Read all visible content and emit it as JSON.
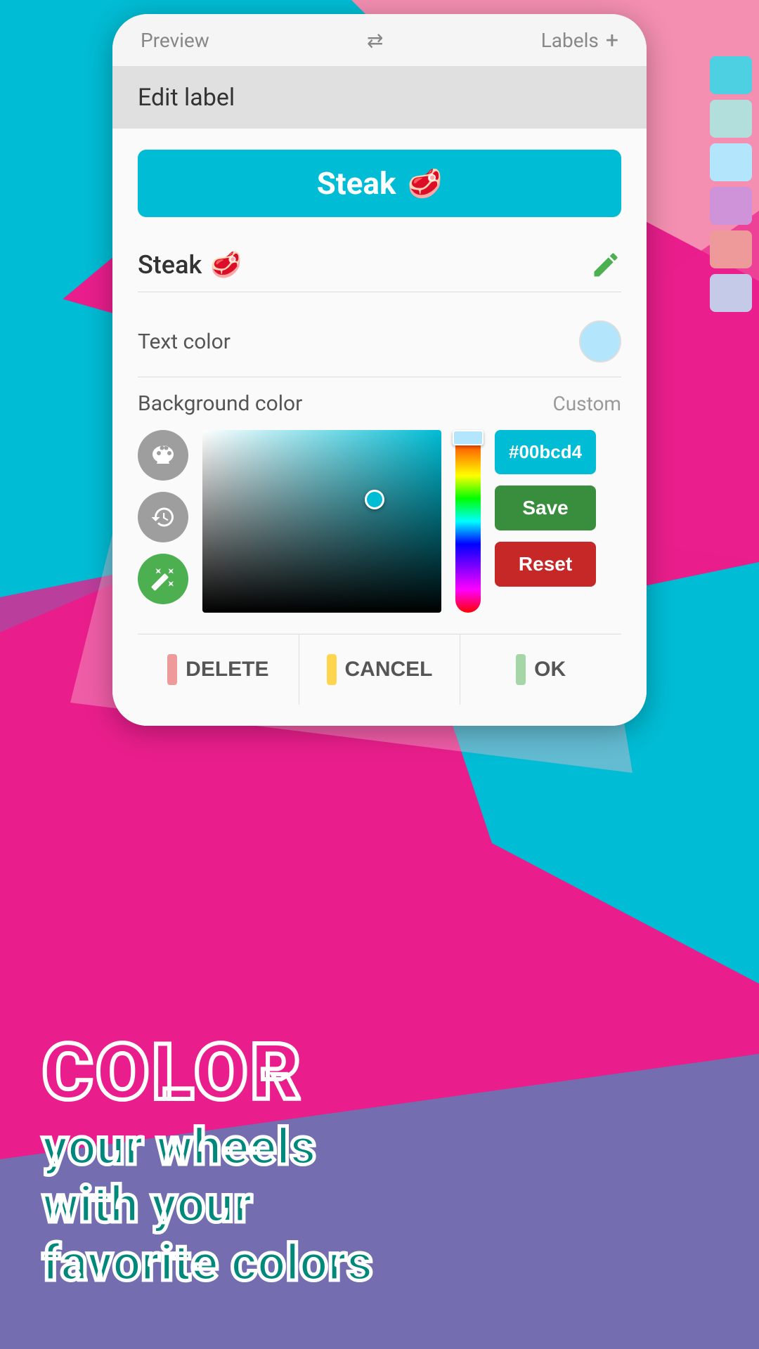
{
  "background": {
    "colors": [
      "#00bcd4",
      "#e91e8c",
      "#ce93d8"
    ]
  },
  "topbar": {
    "preview_label": "Preview",
    "labels_label": "Labels",
    "shuffle_icon": "⇄",
    "add_icon": "+"
  },
  "dialog": {
    "title": "Edit label",
    "label_name": "Steak",
    "label_emoji": "🥩",
    "preview_bg": "#00bcd4",
    "preview_text": "Steak",
    "text_color_label": "Text color",
    "text_color_value": "#b3e5fc",
    "bg_color_label": "Background color",
    "bg_color_custom": "Custom",
    "hex_value": "#00bcd4",
    "save_label": "Save",
    "reset_label": "Reset",
    "delete_label": "DELETE",
    "cancel_label": "CANCEL",
    "ok_label": "OK",
    "delete_accent": "#ef9a9a",
    "cancel_accent": "#ffd54f",
    "ok_accent": "#a5d6a7"
  },
  "promo": {
    "word": "COLOR",
    "line1": "your wheels",
    "line2": "with your",
    "line3": "favorite colors"
  },
  "swatches": [
    "#4dd0e1",
    "#b2dfdb",
    "#b3e5fc",
    "#ce93d8",
    "#ef9a9a",
    "#c5cae9"
  ]
}
